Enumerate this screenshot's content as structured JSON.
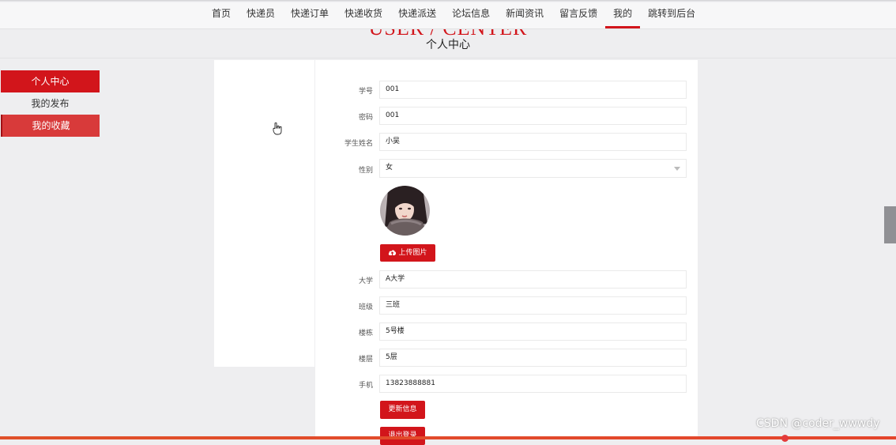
{
  "nav": {
    "items": [
      "首页",
      "快递员",
      "快递订单",
      "快递收货",
      "快递派送",
      "论坛信息",
      "新闻资讯",
      "留言反馈",
      "我的",
      "跳转到后台"
    ],
    "active": "我的"
  },
  "banner": {
    "title_en": "USER / CENTER",
    "title_cn": "个人中心"
  },
  "sidebar": {
    "items": [
      "个人中心",
      "我的发布",
      "我的收藏"
    ],
    "active": "个人中心",
    "hovered": "我的收藏"
  },
  "form": {
    "student_id": {
      "label": "学号",
      "value": "001"
    },
    "password": {
      "label": "密码",
      "value": "001"
    },
    "student_name": {
      "label": "学生姓名",
      "value": "小吴"
    },
    "gender": {
      "label": "性别",
      "value": "女"
    },
    "upload_label": "上传图片",
    "university": {
      "label": "大学",
      "value": "A大学"
    },
    "class": {
      "label": "班级",
      "value": "三班"
    },
    "building": {
      "label": "楼栋",
      "value": "5号楼"
    },
    "floor": {
      "label": "楼层",
      "value": "5层"
    },
    "phone": {
      "label": "手机",
      "value": "13823888881"
    },
    "update_label": "更新信息",
    "logout_label": "退出登录"
  },
  "watermark": "CSDN @coder_wwwdy",
  "colors": {
    "accent": "#d2151b",
    "background": "#eeeef0"
  },
  "icons": {
    "upload": "cloud-upload-icon"
  }
}
